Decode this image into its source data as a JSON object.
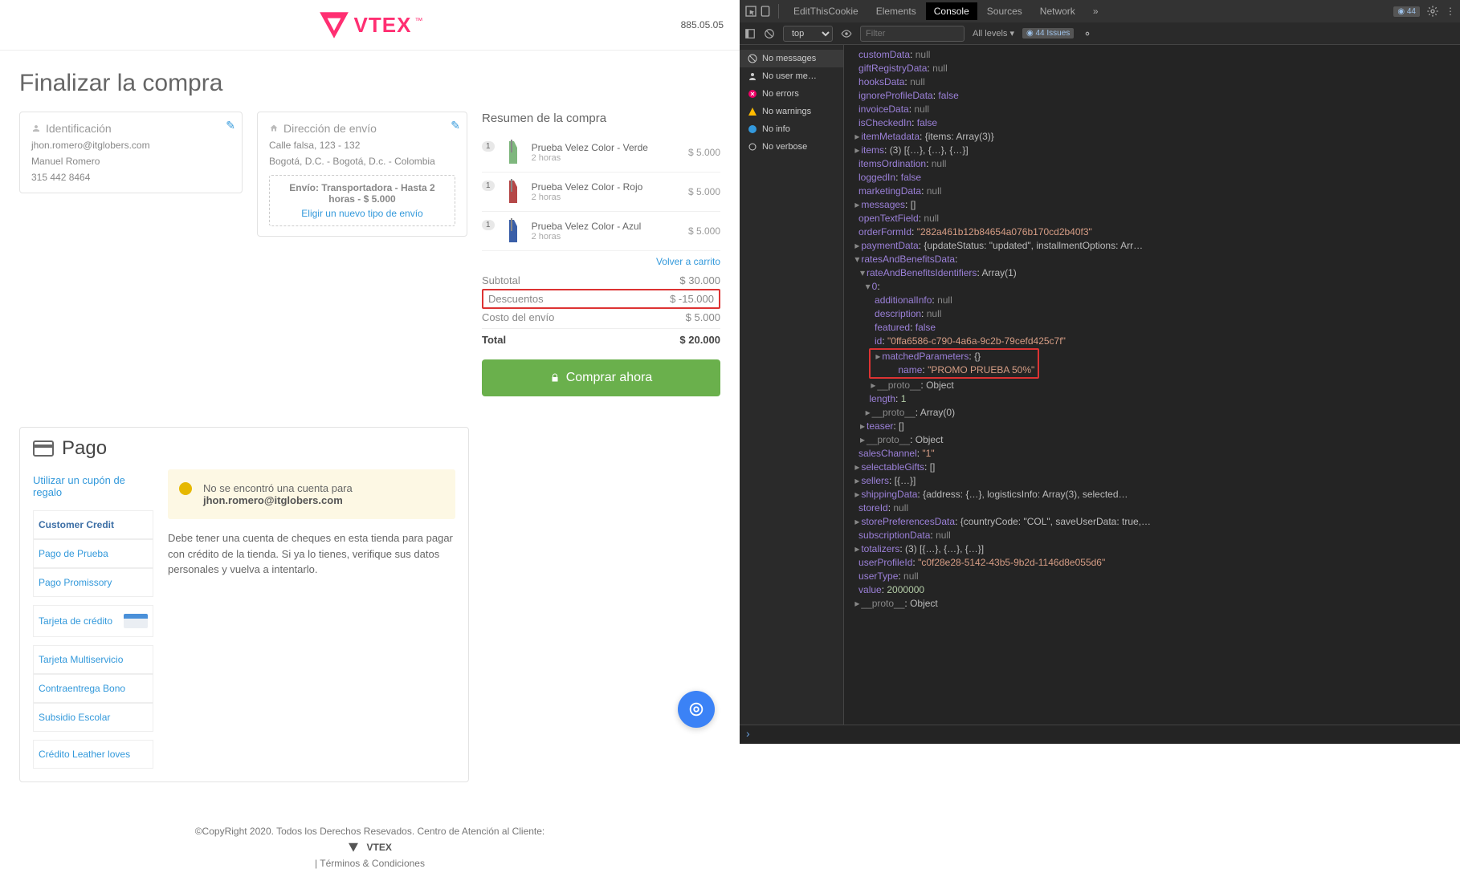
{
  "header": {
    "brand": "VTEX",
    "version": "885.05.05"
  },
  "page_title": "Finalizar la compra",
  "identification": {
    "title": "Identificación",
    "email": "jhon.romero@itglobers.com",
    "name": "Manuel Romero",
    "phone": "315 442 8464"
  },
  "shipping": {
    "title": "Dirección de envío",
    "street": "Calle falsa, 123 - 132",
    "city": "Bogotá, D.C. - Bogotá, D.c. - Colombia",
    "method_label": "Envío: Transportadora - Hasta 2 horas - $ 5.000",
    "change_link": "Eligir un nuevo tipo de envío"
  },
  "payment": {
    "title": "Pago",
    "coupon_link": "Utilizar un cupón de regalo",
    "options": [
      "Customer Credit",
      "Pago de Prueba",
      "Pago Promissory",
      "Tarjeta de crédito",
      "Tarjeta Multiservicio",
      "Contraentrega Bono",
      "Subsidio Escolar",
      "Crédito Leather loves"
    ],
    "warn_line1": "No se encontró una cuenta para",
    "warn_email": "jhon.romero@itglobers.com",
    "help": "Debe tener una cuenta de cheques en esta tienda para pagar con crédito de la tienda. Si ya lo tienes, verifique sus datos personales y vuelva a intentarlo."
  },
  "summary": {
    "title": "Resumen de la compra",
    "items": [
      {
        "qty": "1",
        "name": "Prueba Velez Color - Verde",
        "time": "2 horas",
        "price": "$ 5.000",
        "color": "#7fb77e"
      },
      {
        "qty": "1",
        "name": "Prueba Velez Color - Rojo",
        "time": "2 horas",
        "price": "$ 5.000",
        "color": "#b54848"
      },
      {
        "qty": "1",
        "name": "Prueba Velez Color - Azul",
        "time": "2 horas",
        "price": "$ 5.000",
        "color": "#3a5fa8"
      }
    ],
    "back_link": "Volver a carrito",
    "subtotal_label": "Subtotal",
    "subtotal": "$ 30.000",
    "discount_label": "Descuentos",
    "discount": "$ -15.000",
    "ship_label": "Costo del envío",
    "ship": "$ 5.000",
    "total_label": "Total",
    "total": "$ 20.000",
    "buy_label": "Comprar ahora"
  },
  "footer": {
    "copy": "©CopyRight 2020. Todos los Derechos Resevados. Centro de Atención al Cliente:",
    "terms": "| Términos & Condiciones"
  },
  "devtools": {
    "tabs": [
      "EditThisCookie",
      "Elements",
      "Console",
      "Sources",
      "Network"
    ],
    "active_tab": "Console",
    "issues_badge": "44",
    "issues_link": "44 Issues",
    "context": "top",
    "filter_placeholder": "Filter",
    "levels": "All levels ▾",
    "side": [
      {
        "icon": "ban",
        "label": "No messages",
        "sel": true
      },
      {
        "icon": "user",
        "label": "No user me…"
      },
      {
        "icon": "err",
        "label": "No errors"
      },
      {
        "icon": "warn",
        "label": "No warnings"
      },
      {
        "icon": "info",
        "label": "No info"
      },
      {
        "icon": "bug",
        "label": "No verbose"
      }
    ],
    "obj": {
      "customData": "null",
      "giftRegistryData": "null",
      "hooksData": "null",
      "ignoreProfileData": "false",
      "invoiceData": "null",
      "isCheckedIn": "false",
      "itemMetadata": "{items: Array(3)}",
      "items": "(3) [{…}, {…}, {…}]",
      "itemsOrdination": "null",
      "loggedIn": "false",
      "marketingData": "null",
      "messages": "[]",
      "openTextField": "null",
      "orderFormId": "\"282a461b12b84654a076b170cd2b40f3\"",
      "paymentData": "{updateStatus: \"updated\", installmentOptions: Arr…",
      "ratesAndBenefitsData": ":",
      "rateAndBenefitsIdentifiers": "Array(1)",
      "idx": "0",
      "additionalInfo": "null",
      "description": "null",
      "featured": "false",
      "id": "\"0ffa6586-c790-4a6a-9c2b-79cefd425c7f\"",
      "matchedParameters": "{}",
      "promo_name": "\"PROMO PRUEBA 50%\"",
      "proto": "Object",
      "length": "1",
      "proto2": "Array(0)",
      "teaser": "[]",
      "proto3": "Object",
      "salesChannel": "\"1\"",
      "selectableGifts": "[]",
      "sellers": "[{…}]",
      "shippingData": "{address: {…}, logisticsInfo: Array(3), selected…",
      "storeId": "null",
      "storePreferencesData": "{countryCode: \"COL\", saveUserData: true,…",
      "subscriptionData": "null",
      "totalizers": "(3) [{…}, {…}, {…}]",
      "userProfileId": "\"c0f28e28-5142-43b5-9b2d-1146d8e055d6\"",
      "userType": "null",
      "value": "2000000",
      "proto4": "Object"
    }
  }
}
